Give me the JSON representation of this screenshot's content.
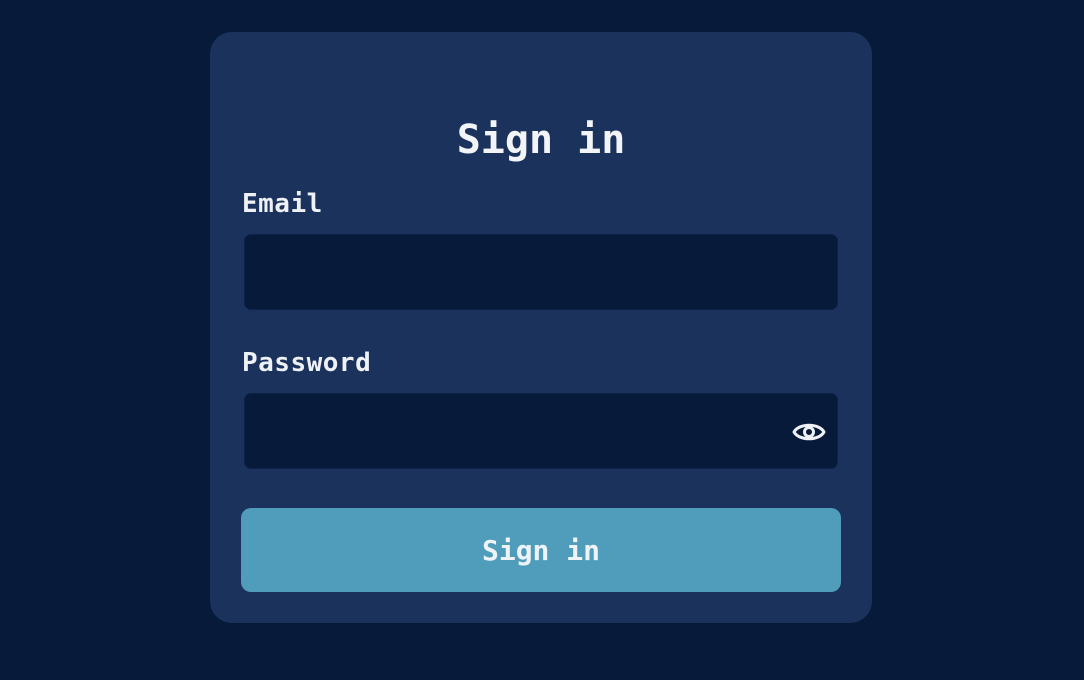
{
  "form": {
    "title": "Sign in",
    "email": {
      "label": "Email",
      "value": "",
      "placeholder": ""
    },
    "password": {
      "label": "Password",
      "value": "",
      "placeholder": "",
      "toggle_icon": "eye-icon"
    },
    "submit_label": "Sign in"
  },
  "colors": {
    "page_background": "#071a3a",
    "card_background": "#1b335c",
    "input_background": "#071a3a",
    "button_background": "#4f9dbb",
    "text": "#eef1f6"
  }
}
